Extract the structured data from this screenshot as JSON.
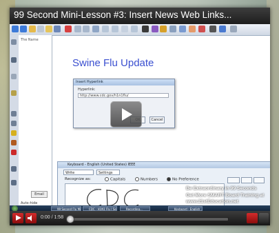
{
  "video": {
    "title": "99 Second Mini-Lesson #3: Insert News Web Links...",
    "time_current": "0:00",
    "time_total": "1:58",
    "time_display": "0:00 / 1:58",
    "progress_fraction": 0.0
  },
  "slide": {
    "heading": "Swine Flu Update"
  },
  "page_panel": {
    "tag": "The Name",
    "button": "Email",
    "autohide": "Auto-hide"
  },
  "dialog": {
    "title": "Insert Hyperlink",
    "field_label": "Hyperlink:",
    "url_value": "http://www.cdc.gov/h1n1flu/",
    "ok": "OK",
    "cancel": "Cancel"
  },
  "handwriting": {
    "title": "Keyboard - English (United States) IEEE",
    "mode": "Write",
    "settings": "Settings",
    "recognize_label": "Recognize as:",
    "options": [
      "Capitals",
      "Numbers",
      "No Preference"
    ],
    "selected_option": "No Preference",
    "written_text": "CDC"
  },
  "overlay": {
    "line1": "Be Extraordinary in 99 Seconds",
    "line2": "Get More SMART Board Training at",
    "line3": "www.21stEducation.net"
  },
  "taskbar": {
    "items": [
      "99 Second Flu Mini...",
      "CDC - H1N1 Flu | Se...",
      "Recording...",
      "Keyboard - English ..."
    ]
  },
  "colors": {
    "heading": "#3a4fd0",
    "player_accent": "#b00000"
  }
}
